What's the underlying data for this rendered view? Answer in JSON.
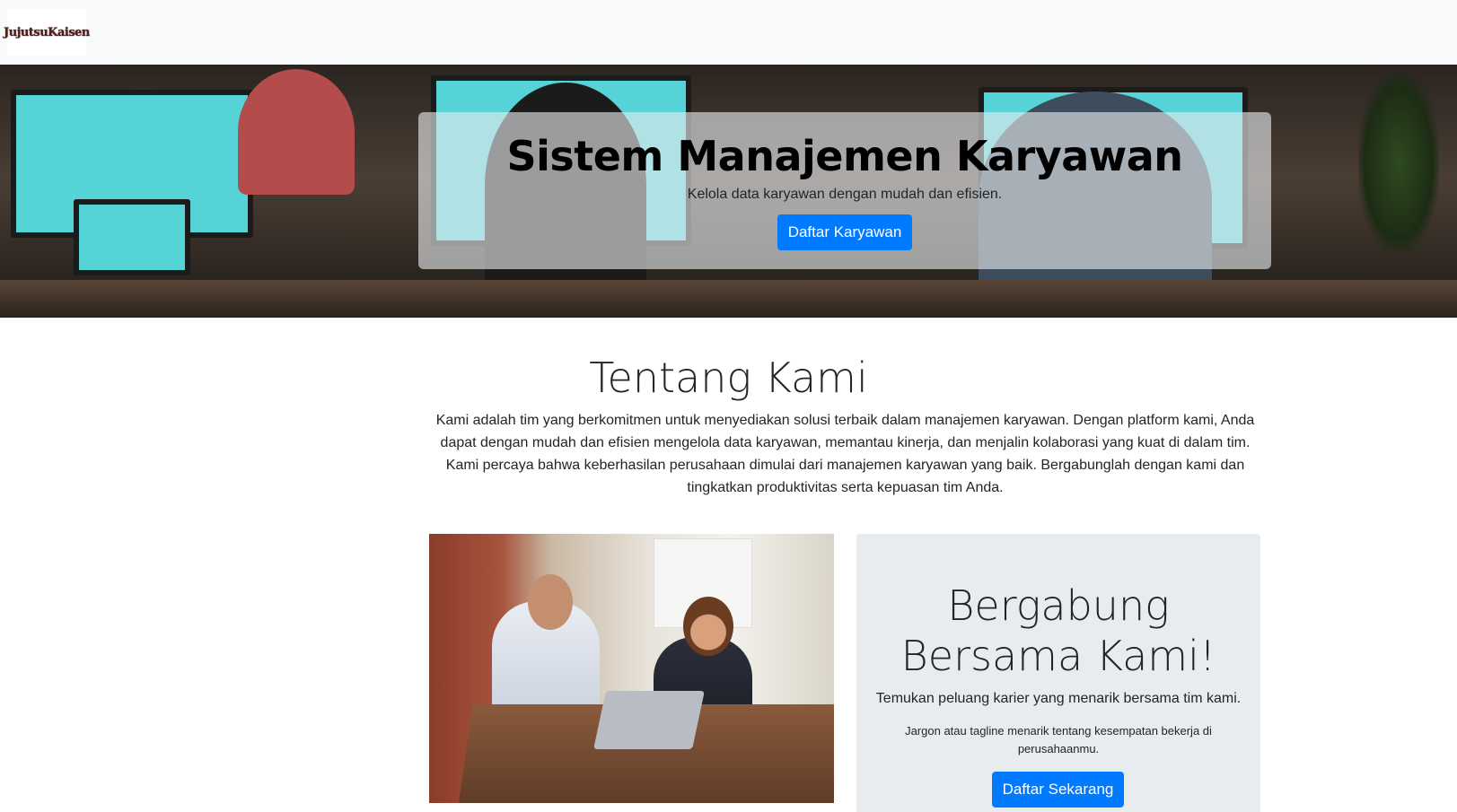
{
  "navbar": {
    "brand_text": "JujutsuKaisen"
  },
  "hero": {
    "title": "Sistem Manajemen Karyawan",
    "subtitle": "Kelola data karyawan dengan mudah dan efisien.",
    "button_label": "Daftar Karyawan"
  },
  "about": {
    "title": "Tentang Kami",
    "text": "Kami adalah tim yang berkomitmen untuk menyediakan solusi terbaik dalam manajemen karyawan. Dengan platform kami, Anda dapat dengan mudah dan efisien mengelola data karyawan, memantau kinerja, dan menjalin kolaborasi yang kuat di dalam tim. Kami percaya bahwa keberhasilan perusahaan dimulai dari manajemen karyawan yang baik. Bergabunglah dengan kami dan tingkatkan produktivitas serta kepuasan tim Anda."
  },
  "join": {
    "title": "Bergabung Bersama Kami!",
    "subtitle": "Temukan peluang karier yang menarik bersama tim kami.",
    "tagline": "Jargon atau tagline menarik tentang kesempatan bekerja di perusahaanmu.",
    "button_label": "Daftar Sekarang"
  },
  "colors": {
    "primary": "#007bff",
    "navbar_bg": "#f8f9fa",
    "card_bg": "#e9ecef"
  }
}
